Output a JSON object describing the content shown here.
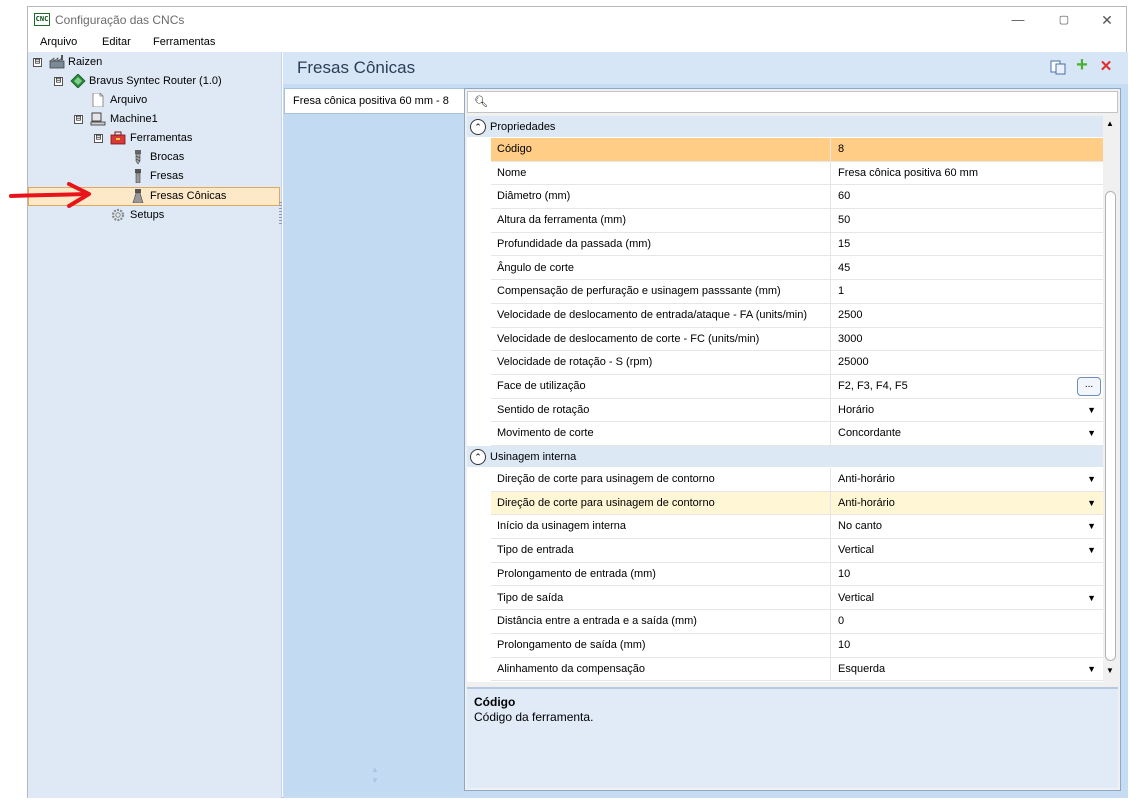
{
  "window": {
    "title": "Configuração das CNCs",
    "app_icon_text": "CNC",
    "controls": {
      "minimize": "—",
      "maximize": "▢",
      "close": "✕"
    }
  },
  "menu": [
    "Arquivo",
    "Editar",
    "Ferramentas"
  ],
  "tree": {
    "nodes": [
      {
        "label": "Raizen",
        "icon": "factory-icon",
        "expander": "⊟"
      },
      {
        "label": "Bravus Syntec Router (1.0)",
        "icon": "machine-diamond-icon",
        "expander": "⊟"
      },
      {
        "label": "Arquivo",
        "icon": "document-icon"
      },
      {
        "label": "Machine1",
        "icon": "computer-icon",
        "expander": "⊟"
      },
      {
        "label": "Ferramentas",
        "icon": "toolbox-icon",
        "expander": "⊟"
      },
      {
        "label": "Brocas",
        "icon": "drill-bit-icon"
      },
      {
        "label": "Fresas",
        "icon": "end-mill-icon"
      },
      {
        "label": "Fresas Cônicas",
        "icon": "conical-mill-icon"
      },
      {
        "label": "Setups",
        "icon": "gear-icon"
      }
    ],
    "selected": "Fresas Cônicas"
  },
  "main": {
    "title": "Fresas Cônicas",
    "toolbar": {
      "copy": "copy-icon",
      "add": "+",
      "delete": "✕"
    },
    "tool_list": [
      "Fresa cônica positiva 60 mm - 8"
    ],
    "search": {
      "value": ""
    },
    "categories": [
      {
        "label": "Propriedades",
        "toggle": "⌃",
        "rows": [
          {
            "name": "Código",
            "value": "8",
            "state": "selected"
          },
          {
            "name": "Nome",
            "value": "Fresa cônica positiva 60 mm"
          },
          {
            "name": "Diâmetro (mm)",
            "value": "60"
          },
          {
            "name": "Altura da ferramenta (mm)",
            "value": "50"
          },
          {
            "name": "Profundidade da passada (mm)",
            "value": "15"
          },
          {
            "name": "Ângulo de corte",
            "value": "45"
          },
          {
            "name": "Compensação de perfuração e usinagem passsante (mm)",
            "value": "1"
          },
          {
            "name": "Velocidade de deslocamento de entrada/ataque - FA (units/min)",
            "value": "2500"
          },
          {
            "name": "Velocidade de deslocamento de corte - FC (units/min)",
            "value": "3000"
          },
          {
            "name": "Velocidade de rotação - S (rpm)",
            "value": "25000"
          },
          {
            "name": "Face de utilização",
            "value": "F2, F3, F4, F5",
            "ellipsis": "..."
          },
          {
            "name": "Sentido de rotação",
            "value": "Horário",
            "dropdown": "▼"
          },
          {
            "name": "Movimento de corte",
            "value": "Concordante",
            "dropdown": "▼"
          }
        ]
      },
      {
        "label": "Usinagem interna",
        "toggle": "⌃",
        "rows": [
          {
            "name": "Direção de corte para usinagem de contorno",
            "value": "Anti-horário",
            "dropdown": "▼"
          },
          {
            "name": "Direção de corte para usinagem de contorno",
            "value": "Anti-horário",
            "dropdown": "▼",
            "state": "hover"
          },
          {
            "name": "Início da usinagem interna",
            "value": "No canto",
            "dropdown": "▼"
          },
          {
            "name": "Tipo de entrada",
            "value": "Vertical",
            "dropdown": "▼"
          },
          {
            "name": "Prolongamento de entrada (mm)",
            "value": "10"
          },
          {
            "name": "Tipo de saída",
            "value": "Vertical",
            "dropdown": "▼"
          },
          {
            "name": "Distância entre a entrada e a saída (mm)",
            "value": "0"
          },
          {
            "name": "Prolongamento de saída (mm)",
            "value": "10"
          },
          {
            "name": "Alinhamento da compensação",
            "value": "Esquerda",
            "dropdown": "▼"
          }
        ]
      }
    ],
    "description": {
      "title": "Código",
      "text": "Código da ferramenta."
    }
  },
  "colors": {
    "selection": "#ffcd86",
    "hover": "#fff6d6",
    "panel_blue": "#c6dcf2",
    "annotation_arrow": "#e8141c"
  }
}
